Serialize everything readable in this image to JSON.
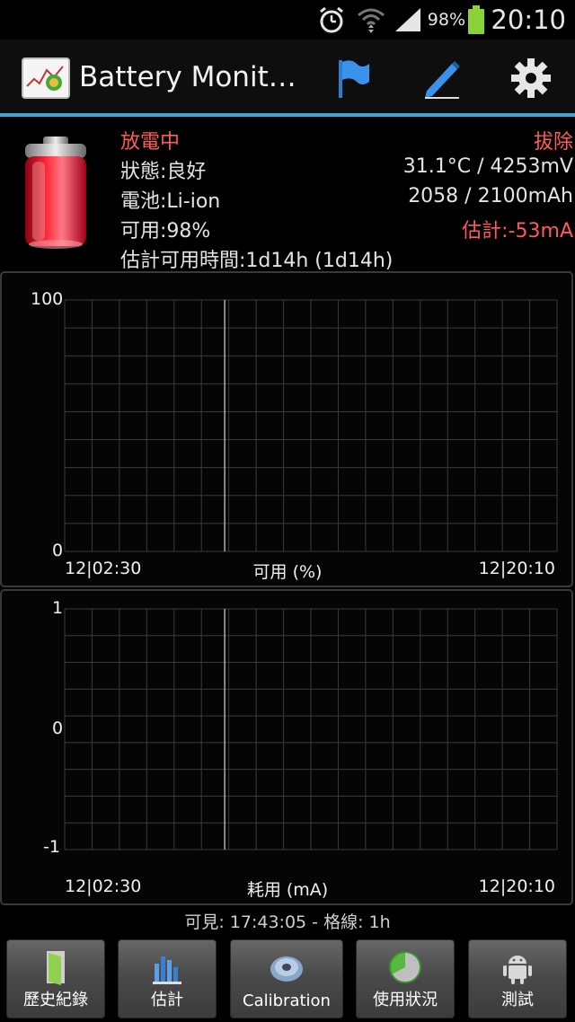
{
  "status_bar": {
    "battery_percent": "98%",
    "time": "20:10",
    "battery_level": 0.98
  },
  "action_bar": {
    "title": "Battery Monit…",
    "buttons": [
      {
        "icon": "flag-icon"
      },
      {
        "icon": "pen-icon"
      },
      {
        "icon": "gear-icon"
      }
    ],
    "accent": "#3aa7d8"
  },
  "info": {
    "state": "放電中",
    "plug": "拔除",
    "status": "狀態:良好",
    "temp_voltage": "31.1°C / 4253mV",
    "battery_type": "電池:Li-ion",
    "capacity": "2058 / 2100mAh",
    "available": "可用:98%",
    "estimate_current": "估計:-53mA",
    "remaining_time": "估計可用時間:1d14h (1d14h)",
    "red_color": "#ff5b5b"
  },
  "chart_data": [
    {
      "type": "line",
      "title": "可用 (%)",
      "x_start_label": "12|02:30",
      "x_end_label": "12|20:10",
      "y_max_label": "100",
      "y_min_label": "0",
      "ylim": [
        0,
        100
      ],
      "grid": true,
      "series": []
    },
    {
      "type": "line",
      "title": "耗用 (mA)",
      "x_start_label": "12|02:30",
      "x_end_label": "12|20:10",
      "y_max_label": "1",
      "y_mid_label": "0",
      "y_min_label": "-1",
      "ylim": [
        -1,
        1
      ],
      "grid": true,
      "series": []
    }
  ],
  "footer": {
    "visible_line": "可見: 17:43:05 - 格線: 1h",
    "buttons": [
      {
        "label": "歷史紀錄",
        "icon": "door-icon"
      },
      {
        "label": "估計",
        "icon": "estimate-bars-icon"
      },
      {
        "label": "Calibration",
        "icon": "calibration-disc-icon"
      },
      {
        "label": "使用狀況",
        "icon": "usage-pie-icon"
      },
      {
        "label": "測試",
        "icon": "android-icon"
      }
    ]
  }
}
